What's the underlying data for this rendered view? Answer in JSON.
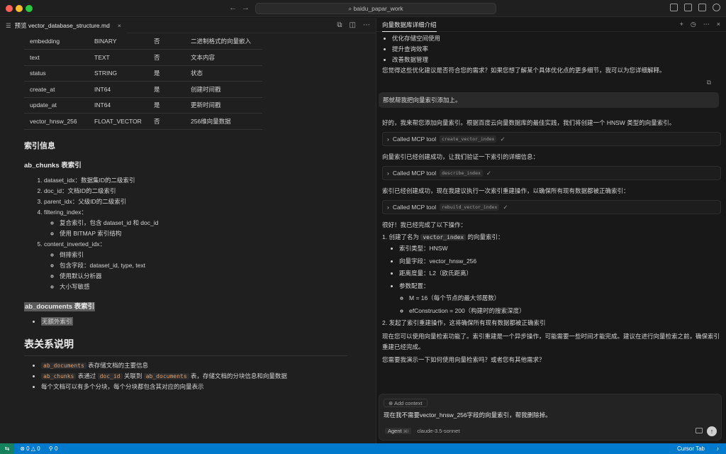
{
  "window": {
    "search": "baidu_papar_work"
  },
  "left_tab": {
    "label": "预览 vector_database_structure.md"
  },
  "table": {
    "rows": [
      [
        "embedding",
        "BINARY",
        "否",
        "二进制格式的向量嵌入"
      ],
      [
        "text",
        "TEXT",
        "否",
        "文本内容"
      ],
      [
        "status",
        "STRING",
        "是",
        "状态"
      ],
      [
        "create_at",
        "INT64",
        "是",
        "创建时间戳"
      ],
      [
        "update_at",
        "INT64",
        "是",
        "更新时间戳"
      ],
      [
        "vector_hnsw_256",
        "FLOAT_VECTOR",
        "否",
        "256维向量数据"
      ]
    ]
  },
  "index_section": {
    "heading": "索引信息",
    "sub": "ab_chunks 表索引",
    "items": [
      "dataset_idx：数据集ID的二级索引",
      "doc_id：文档ID的二级索引",
      "parent_idx：父级ID的二级索引",
      "filtering_index：",
      "content_inverted_idx："
    ],
    "filtering_sub": [
      "复合索引，包含 dataset_id 和 doc_id",
      "使用 BITMAP 索引结构"
    ],
    "content_sub": [
      "倒排索引",
      "包含字段：dataset_id, type, text",
      "使用默认分析器",
      "大小写敏感"
    ],
    "docs_heading": "ab_documents 表索引",
    "docs_item": "无额外索引"
  },
  "relations": {
    "heading": "表关系说明",
    "b1_code": "ab_documents",
    "b1_text": " 表存储文档的主要信息",
    "b2_code1": "ab_chunks",
    "b2_mid": " 表通过 ",
    "b2_code2": "doc_id",
    "b2_mid2": " 关联到 ",
    "b2_code3": "ab_documents",
    "b2_text": " 表，存储文档的分块信息和向量数据",
    "b3": "每个文档可以有多个分块，每个分块都包含其对应的向量表示"
  },
  "right_tab": {
    "label": "向量数据库详细介绍"
  },
  "chat": {
    "bullets_top": [
      "优化存储空间使用",
      "提升查询效率",
      "改善数据管理"
    ],
    "q1": "您觉得这些优化建议是否符合您的需求？如果您想了解某个具体优化点的更多细节，我可以为您详细解释。",
    "user1": "那就帮我把向量索引添加上。",
    "a1": "好的，我来帮您添加向量索引。根据百度云向量数据库的最佳实践，我们将创建一个 HNSW 类型的向量索引。",
    "tool_label": "Called MCP tool",
    "tool1": "create_vector_index",
    "a2": "向量索引已经创建成功，让我们验证一下索引的详细信息：",
    "tool2": "describe_index",
    "a3": "索引已经创建成功，现在我建议执行一次索引重建操作，以确保所有现有数据都被正确索引：",
    "tool3": "rebuild_vector_index",
    "a4": "很好！我已经完成了以下操作：",
    "s1_pre": "1. 创建了名为 ",
    "s1_code": "vector_index",
    "s1_post": " 的向量索引：",
    "s1_items": [
      "索引类型：HNSW",
      "向量字段：vector_hnsw_256",
      "距离度量：L2（欧氏距离）",
      "参数配置："
    ],
    "s1_params": [
      "M = 16（每个节点的最大邻居数）",
      "efConstruction = 200（构建时的搜索深度）"
    ],
    "s2": "2. 发起了索引重建操作，这将确保所有现有数据都被正确索引",
    "a5": "现在您可以使用向量检索功能了。索引重建是一个异步操作，可能需要一些时间才能完成。建议在进行向量检索之前，确保索引重建已经完成。",
    "a6": "您需要我演示一下如何使用向量检索吗？或者您有其他需求？"
  },
  "composer": {
    "add_context": "Add context",
    "text": "现在我不需要vector_hnsw_256字段的向量索引，帮我删除掉。",
    "agent": "Agent",
    "agent_key": "⌘I",
    "model": "claude-3.5-sonnet"
  },
  "status": {
    "errors": "0",
    "warnings": "0",
    "ports": "0",
    "right": "Cursor Tab"
  }
}
